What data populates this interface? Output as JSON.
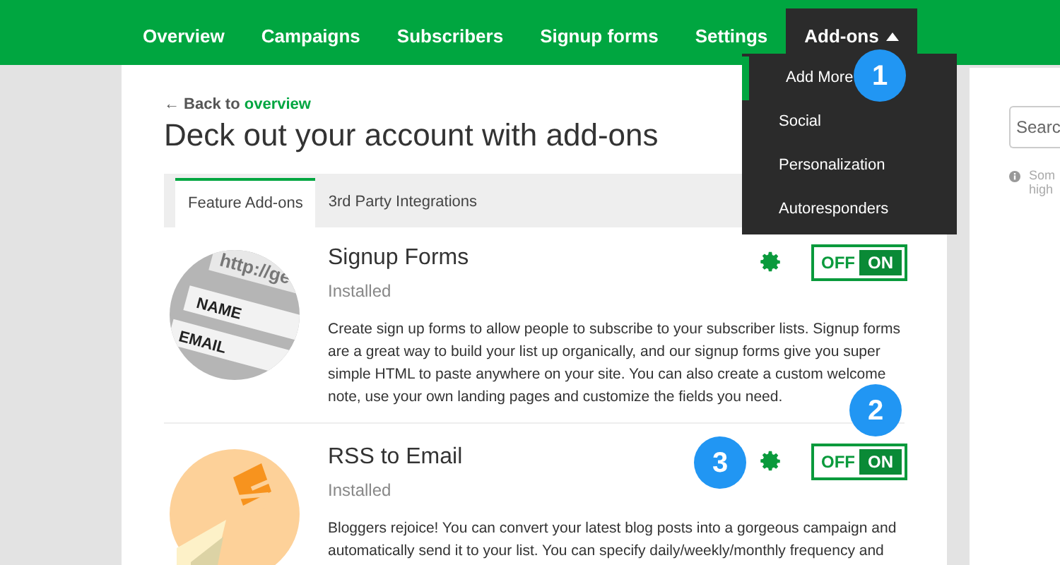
{
  "nav": {
    "items": [
      {
        "label": "Overview",
        "selected": false
      },
      {
        "label": "Campaigns",
        "selected": false
      },
      {
        "label": "Subscribers",
        "selected": false
      },
      {
        "label": "Signup forms",
        "selected": false
      },
      {
        "label": "Settings",
        "selected": false
      },
      {
        "label": "Add-ons",
        "selected": true,
        "expanded": true
      }
    ]
  },
  "dropdown": {
    "items": [
      {
        "label": "Add More",
        "selected": true
      },
      {
        "label": "Social",
        "selected": false
      },
      {
        "label": "Personalization",
        "selected": false
      },
      {
        "label": "Autoresponders",
        "selected": false
      }
    ]
  },
  "back_link": {
    "prefix": "← Back to",
    "link": "overview"
  },
  "heading": "Deck out your account with add-ons",
  "tabs": [
    {
      "label": "Feature Add-ons",
      "selected": true
    },
    {
      "label": "3rd Party Integrations",
      "selected": false
    }
  ],
  "addons": [
    {
      "kind": "forms",
      "title": "Signup Forms",
      "status": "Installed",
      "on": true,
      "off_label": "OFF",
      "on_label": "ON",
      "description": "Create sign up forms to allow people to subscribe to your subscriber lists. Signup forms are a great way to build your list up organically, and our signup forms give you super simple HTML to paste anywhere on your site. You can also create a custom welcome note, use your own landing pages and customize the fields you need.",
      "image_text": [
        "http://ge",
        "NAME",
        "EMAIL"
      ]
    },
    {
      "kind": "rss",
      "title": "RSS to Email",
      "status": "Installed",
      "on": true,
      "off_label": "OFF",
      "on_label": "ON",
      "description": "Bloggers rejoice! You can convert your latest blog posts into a gorgeous campaign and automatically send it to your list. You can specify daily/weekly/monthly frequency and"
    }
  ],
  "side": {
    "search_placeholder": "Searc",
    "note": [
      "Som",
      "high"
    ]
  },
  "callouts": [
    {
      "label": "1"
    },
    {
      "label": "2"
    },
    {
      "label": "3"
    }
  ]
}
